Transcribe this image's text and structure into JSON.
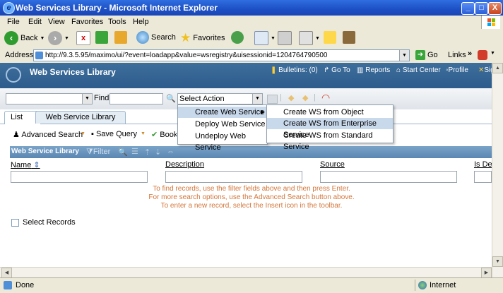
{
  "window": {
    "title": "Web Services Library - Microsoft Internet Explorer",
    "minimize": "_",
    "maximize": "□",
    "close": "X"
  },
  "menubar": [
    "File",
    "Edit",
    "View",
    "Favorites",
    "Tools",
    "Help"
  ],
  "stdbar": {
    "back": "Back",
    "search": "Search",
    "favorites": "Favorites"
  },
  "address": {
    "label": "Address",
    "url": "http://9.3.5.95/maximo/ui/?event=loadapp&value=wsregistry&uisessionid=1204764790500",
    "go": "Go",
    "links": "Links"
  },
  "app": {
    "title": "Web Services Library",
    "nav": {
      "bulletins": "Bulletins: (0)",
      "goto": "Go To",
      "reports": "Reports",
      "startcenter": "Start Center",
      "profile": "Profile",
      "signout": "Sign Out"
    }
  },
  "toolbar": {
    "find": "Find",
    "action_select": "Select Action"
  },
  "tabs": [
    "List",
    "Web Service Library"
  ],
  "query_bar": {
    "advanced_search": "Advanced Search",
    "save_query": "Save Query",
    "bookmarks": "Bookmarks"
  },
  "table": {
    "title": "Web Service Library",
    "filter": "Filter",
    "columns": [
      "Name",
      "Description",
      "Source",
      "Is Deployed"
    ],
    "messages": [
      "To find records, use the filter fields above and then press Enter.",
      "For more search options, use the Advanced Search button above.",
      "To enter a new record, select the Insert icon in the toolbar."
    ],
    "select_records": "Select Records"
  },
  "action_menu": {
    "items": [
      "Create Web Service",
      "Deploy Web Service",
      "Undeploy Web Service"
    ],
    "submenu": [
      "Create WS from Object Structure",
      "Create WS from Enterprise Service",
      "Create WS from Standard Service"
    ]
  },
  "status": {
    "left": "Done",
    "zone": "Internet"
  }
}
